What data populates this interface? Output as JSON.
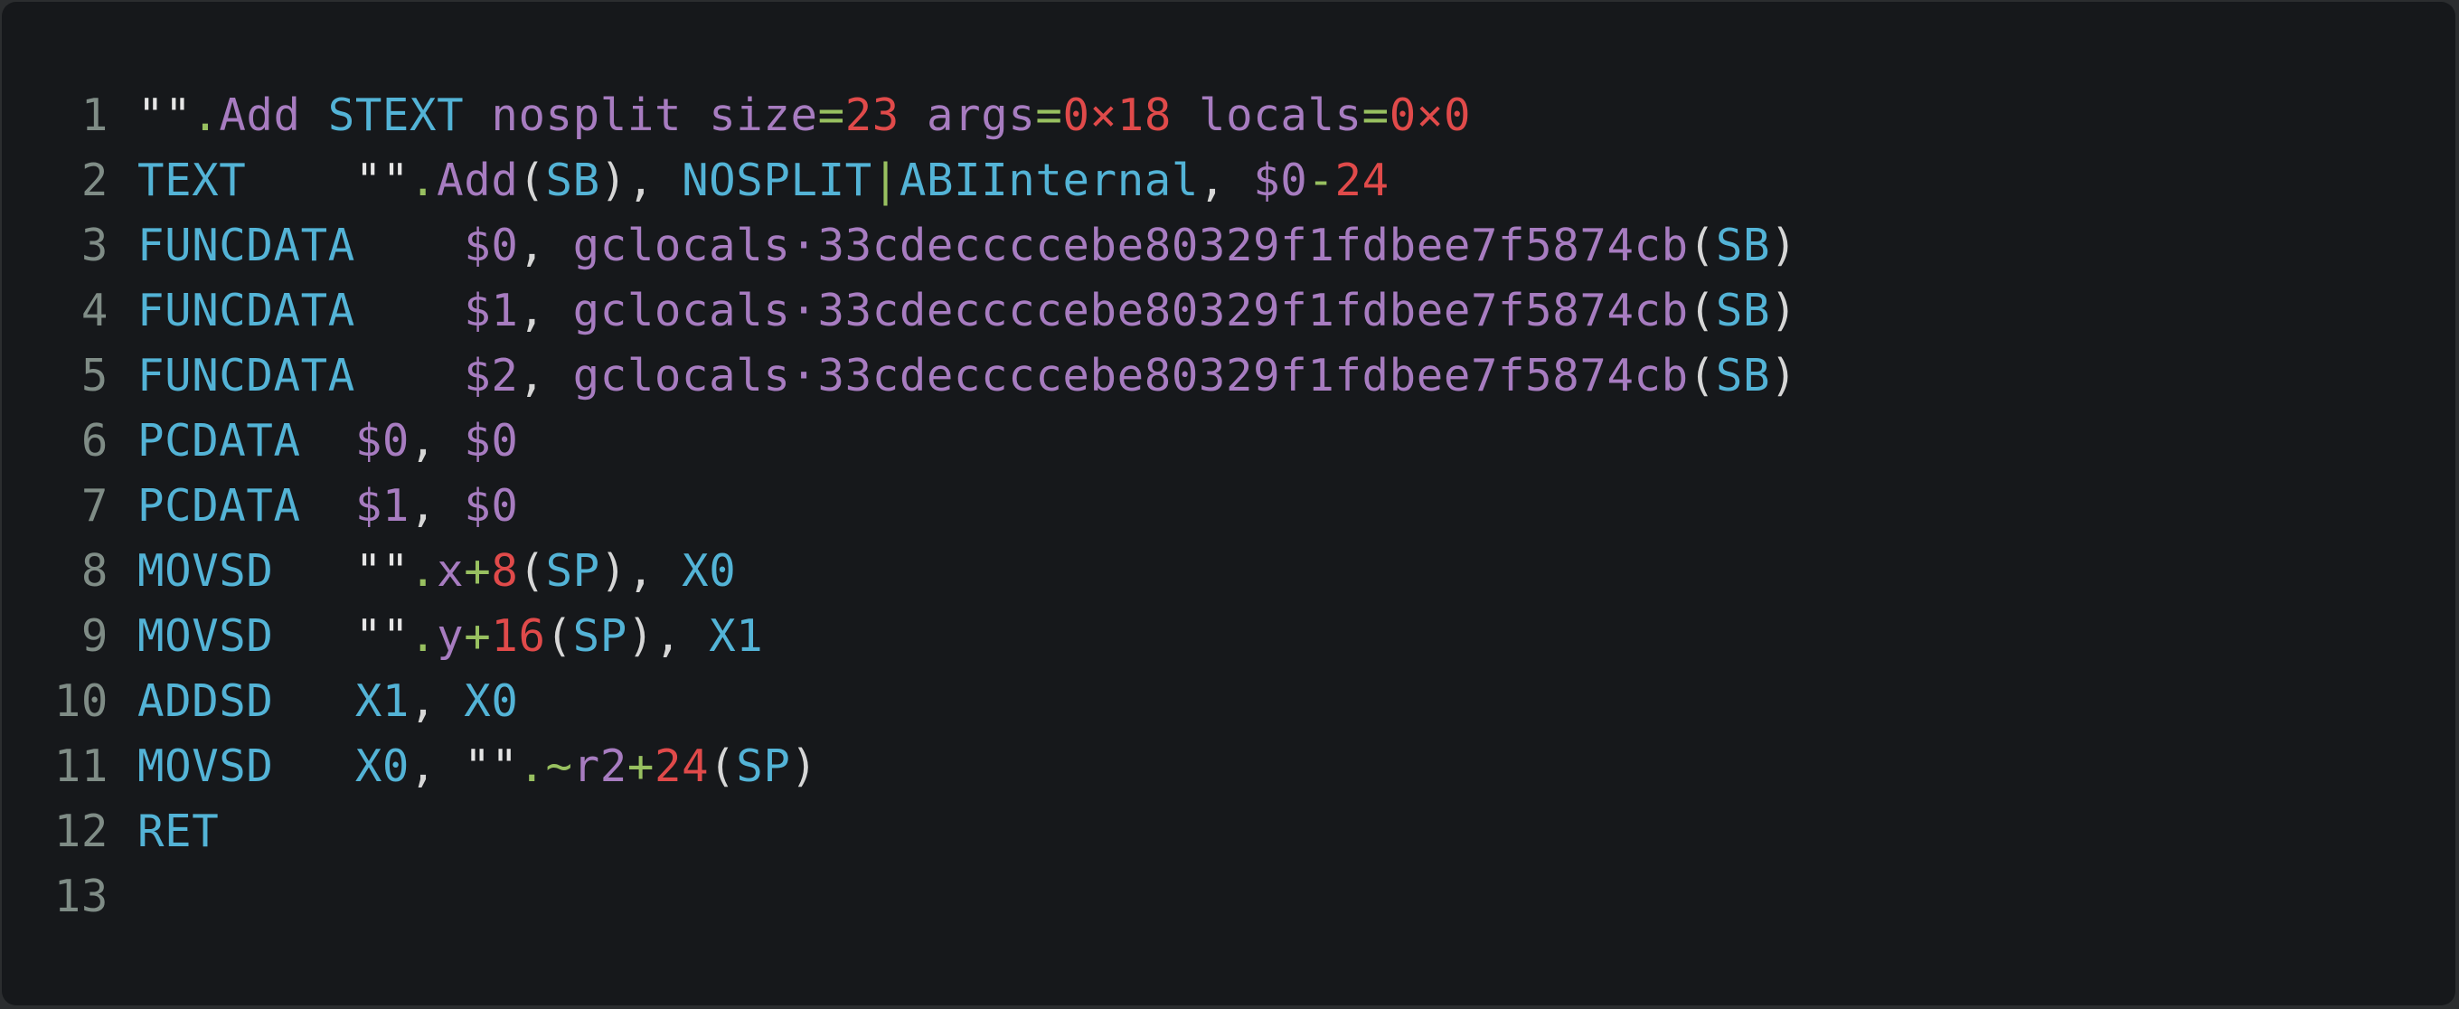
{
  "colors": {
    "background": "#16181b",
    "line_number": "#7f8c86",
    "keyword": "#53b3d6",
    "string": "#e6e6e6",
    "operator": "#98c060",
    "identifier": "#a77cc0",
    "number": "#e04a4a",
    "punctuation": "#d6d6d6"
  },
  "code_lines": [
    {
      "num": "1",
      "tokens": [
        {
          "t": "\"\"",
          "c": "t-str"
        },
        {
          "t": ".",
          "c": "t-op"
        },
        {
          "t": "Add",
          "c": "t-id"
        },
        {
          "t": " ",
          "c": "t-str"
        },
        {
          "t": "STEXT",
          "c": "t-kw"
        },
        {
          "t": " ",
          "c": "t-str"
        },
        {
          "t": "nosplit",
          "c": "t-id"
        },
        {
          "t": " ",
          "c": "t-str"
        },
        {
          "t": "size",
          "c": "t-id"
        },
        {
          "t": "=",
          "c": "t-op"
        },
        {
          "t": "23",
          "c": "t-num"
        },
        {
          "t": " ",
          "c": "t-str"
        },
        {
          "t": "args",
          "c": "t-id"
        },
        {
          "t": "=",
          "c": "t-op"
        },
        {
          "t": "0×18",
          "c": "t-num"
        },
        {
          "t": " ",
          "c": "t-str"
        },
        {
          "t": "locals",
          "c": "t-id"
        },
        {
          "t": "=",
          "c": "t-op"
        },
        {
          "t": "0×0",
          "c": "t-num"
        }
      ]
    },
    {
      "num": "2",
      "tokens": [
        {
          "t": "TEXT",
          "c": "t-kw"
        },
        {
          "t": "    ",
          "c": "t-str"
        },
        {
          "t": "\"\"",
          "c": "t-str"
        },
        {
          "t": ".",
          "c": "t-op"
        },
        {
          "t": "Add",
          "c": "t-id"
        },
        {
          "t": "(",
          "c": "t-punct"
        },
        {
          "t": "SB",
          "c": "t-kw"
        },
        {
          "t": ")",
          "c": "t-punct"
        },
        {
          "t": ", ",
          "c": "t-punct"
        },
        {
          "t": "NOSPLIT",
          "c": "t-kw"
        },
        {
          "t": "|",
          "c": "t-op"
        },
        {
          "t": "ABIInternal",
          "c": "t-kw"
        },
        {
          "t": ", ",
          "c": "t-punct"
        },
        {
          "t": "$0",
          "c": "t-id"
        },
        {
          "t": "-",
          "c": "t-op"
        },
        {
          "t": "24",
          "c": "t-num"
        }
      ]
    },
    {
      "num": "3",
      "tokens": [
        {
          "t": "FUNCDATA",
          "c": "t-kw"
        },
        {
          "t": "    ",
          "c": "t-str"
        },
        {
          "t": "$0",
          "c": "t-id"
        },
        {
          "t": ", ",
          "c": "t-punct"
        },
        {
          "t": "gclocals·33cdeccccebe80329f1fdbee7f5874cb",
          "c": "t-id"
        },
        {
          "t": "(",
          "c": "t-punct"
        },
        {
          "t": "SB",
          "c": "t-kw"
        },
        {
          "t": ")",
          "c": "t-punct"
        }
      ]
    },
    {
      "num": "4",
      "tokens": [
        {
          "t": "FUNCDATA",
          "c": "t-kw"
        },
        {
          "t": "    ",
          "c": "t-str"
        },
        {
          "t": "$1",
          "c": "t-id"
        },
        {
          "t": ", ",
          "c": "t-punct"
        },
        {
          "t": "gclocals·33cdeccccebe80329f1fdbee7f5874cb",
          "c": "t-id"
        },
        {
          "t": "(",
          "c": "t-punct"
        },
        {
          "t": "SB",
          "c": "t-kw"
        },
        {
          "t": ")",
          "c": "t-punct"
        }
      ]
    },
    {
      "num": "5",
      "tokens": [
        {
          "t": "FUNCDATA",
          "c": "t-kw"
        },
        {
          "t": "    ",
          "c": "t-str"
        },
        {
          "t": "$2",
          "c": "t-id"
        },
        {
          "t": ", ",
          "c": "t-punct"
        },
        {
          "t": "gclocals·33cdeccccebe80329f1fdbee7f5874cb",
          "c": "t-id"
        },
        {
          "t": "(",
          "c": "t-punct"
        },
        {
          "t": "SB",
          "c": "t-kw"
        },
        {
          "t": ")",
          "c": "t-punct"
        }
      ]
    },
    {
      "num": "6",
      "tokens": [
        {
          "t": "PCDATA",
          "c": "t-kw"
        },
        {
          "t": "  ",
          "c": "t-str"
        },
        {
          "t": "$0",
          "c": "t-id"
        },
        {
          "t": ", ",
          "c": "t-punct"
        },
        {
          "t": "$0",
          "c": "t-id"
        }
      ]
    },
    {
      "num": "7",
      "tokens": [
        {
          "t": "PCDATA",
          "c": "t-kw"
        },
        {
          "t": "  ",
          "c": "t-str"
        },
        {
          "t": "$1",
          "c": "t-id"
        },
        {
          "t": ", ",
          "c": "t-punct"
        },
        {
          "t": "$0",
          "c": "t-id"
        }
      ]
    },
    {
      "num": "8",
      "tokens": [
        {
          "t": "MOVSD",
          "c": "t-kw"
        },
        {
          "t": "   ",
          "c": "t-str"
        },
        {
          "t": "\"\"",
          "c": "t-str"
        },
        {
          "t": ".",
          "c": "t-op"
        },
        {
          "t": "x",
          "c": "t-id"
        },
        {
          "t": "+",
          "c": "t-op"
        },
        {
          "t": "8",
          "c": "t-num"
        },
        {
          "t": "(",
          "c": "t-punct"
        },
        {
          "t": "SP",
          "c": "t-kw"
        },
        {
          "t": ")",
          "c": "t-punct"
        },
        {
          "t": ", ",
          "c": "t-punct"
        },
        {
          "t": "X0",
          "c": "t-kw"
        }
      ]
    },
    {
      "num": "9",
      "tokens": [
        {
          "t": "MOVSD",
          "c": "t-kw"
        },
        {
          "t": "   ",
          "c": "t-str"
        },
        {
          "t": "\"\"",
          "c": "t-str"
        },
        {
          "t": ".",
          "c": "t-op"
        },
        {
          "t": "y",
          "c": "t-id"
        },
        {
          "t": "+",
          "c": "t-op"
        },
        {
          "t": "16",
          "c": "t-num"
        },
        {
          "t": "(",
          "c": "t-punct"
        },
        {
          "t": "SP",
          "c": "t-kw"
        },
        {
          "t": ")",
          "c": "t-punct"
        },
        {
          "t": ", ",
          "c": "t-punct"
        },
        {
          "t": "X1",
          "c": "t-kw"
        }
      ]
    },
    {
      "num": "10",
      "tokens": [
        {
          "t": "ADDSD",
          "c": "t-kw"
        },
        {
          "t": "   ",
          "c": "t-str"
        },
        {
          "t": "X1",
          "c": "t-kw"
        },
        {
          "t": ", ",
          "c": "t-punct"
        },
        {
          "t": "X0",
          "c": "t-kw"
        }
      ]
    },
    {
      "num": "11",
      "tokens": [
        {
          "t": "MOVSD",
          "c": "t-kw"
        },
        {
          "t": "   ",
          "c": "t-str"
        },
        {
          "t": "X0",
          "c": "t-kw"
        },
        {
          "t": ", ",
          "c": "t-punct"
        },
        {
          "t": "\"\"",
          "c": "t-str"
        },
        {
          "t": ".",
          "c": "t-op"
        },
        {
          "t": "~",
          "c": "t-op"
        },
        {
          "t": "r2",
          "c": "t-id"
        },
        {
          "t": "+",
          "c": "t-op"
        },
        {
          "t": "24",
          "c": "t-num"
        },
        {
          "t": "(",
          "c": "t-punct"
        },
        {
          "t": "SP",
          "c": "t-kw"
        },
        {
          "t": ")",
          "c": "t-punct"
        }
      ]
    },
    {
      "num": "12",
      "tokens": [
        {
          "t": "RET",
          "c": "t-kw"
        }
      ]
    },
    {
      "num": "13",
      "tokens": []
    }
  ]
}
